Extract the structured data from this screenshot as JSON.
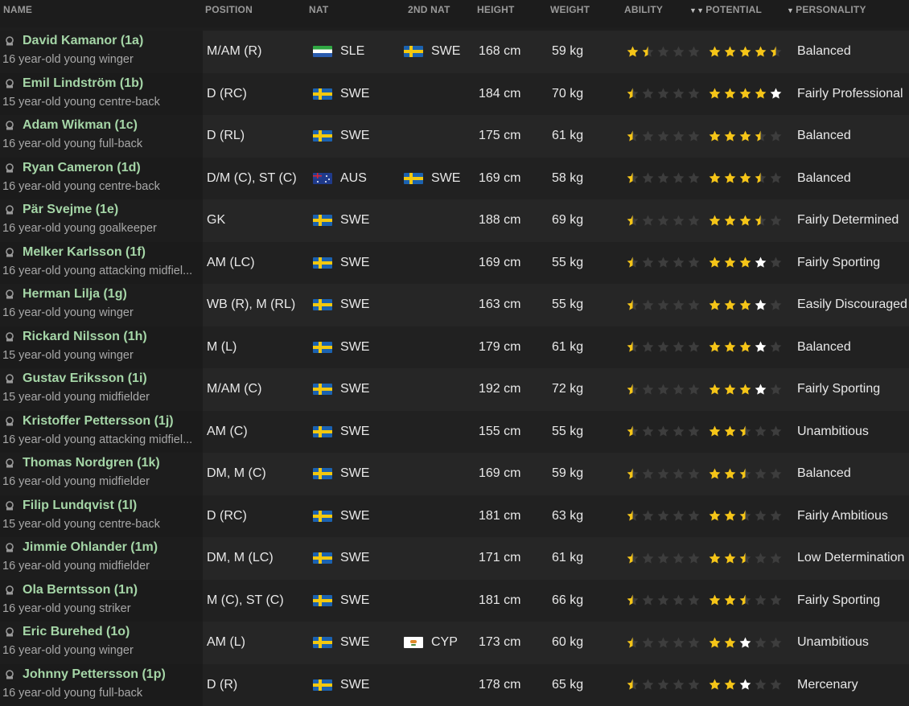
{
  "headers": {
    "name": "NAME",
    "position": "POSITION",
    "nat": "NAT",
    "second_nat": "2ND NAT",
    "height": "HEIGHT",
    "weight": "WEIGHT",
    "ability": "ABILITY",
    "potential": "POTENTIAL",
    "personality": "PERSONALITY"
  },
  "colors": {
    "name_green": "#a5d6a7",
    "star_gold": "#f5c518",
    "star_white": "#ffffff",
    "star_empty": "#3d3d3d"
  },
  "players": [
    {
      "name": "David Kamanor (1a)",
      "desc": "16 year-old young winger",
      "position": "M/AM (R)",
      "nat": "SLE",
      "nat_flag": "sle",
      "second_nat": "SWE",
      "second_flag": "swe",
      "height": "168 cm",
      "weight": "59 kg",
      "ability": 1.5,
      "potential": 4.5,
      "potential_white": 1,
      "personality": "Balanced"
    },
    {
      "name": "Emil Lindström (1b)",
      "desc": "15 year-old young centre-back",
      "position": "D (RC)",
      "nat": "SWE",
      "nat_flag": "swe",
      "second_nat": "",
      "second_flag": "",
      "height": "184 cm",
      "weight": "70 kg",
      "ability": 0.5,
      "potential": 4,
      "potential_white": 1,
      "personality": "Fairly Professional"
    },
    {
      "name": "Adam Wikman (1c)",
      "desc": "16 year-old young full-back",
      "position": "D (RL)",
      "nat": "SWE",
      "nat_flag": "swe",
      "second_nat": "",
      "second_flag": "",
      "height": "175 cm",
      "weight": "61 kg",
      "ability": 0.5,
      "potential": 3.5,
      "potential_white": 0,
      "personality": "Balanced"
    },
    {
      "name": "Ryan Cameron (1d)",
      "desc": "16 year-old young centre-back",
      "position": "D/M (C), ST (C)",
      "nat": "AUS",
      "nat_flag": "aus",
      "second_nat": "SWE",
      "second_flag": "swe",
      "height": "169 cm",
      "weight": "58 kg",
      "ability": 0.5,
      "potential": 3.5,
      "potential_white": 0,
      "personality": "Balanced"
    },
    {
      "name": "Pär Svejme (1e)",
      "desc": "16 year-old young goalkeeper",
      "position": "GK",
      "nat": "SWE",
      "nat_flag": "swe",
      "second_nat": "",
      "second_flag": "",
      "height": "188 cm",
      "weight": "69 kg",
      "ability": 0.5,
      "potential": 3.5,
      "potential_white": 0,
      "personality": "Fairly Determined"
    },
    {
      "name": "Melker Karlsson (1f)",
      "desc": "16 year-old young attacking midfiel...",
      "position": "AM (LC)",
      "nat": "SWE",
      "nat_flag": "swe",
      "second_nat": "",
      "second_flag": "",
      "height": "169 cm",
      "weight": "55 kg",
      "ability": 0.5,
      "potential": 3,
      "potential_white": 1,
      "personality": "Fairly Sporting"
    },
    {
      "name": "Herman Lilja (1g)",
      "desc": "16 year-old young winger",
      "position": "WB (R), M (RL)",
      "nat": "SWE",
      "nat_flag": "swe",
      "second_nat": "",
      "second_flag": "",
      "height": "163 cm",
      "weight": "55 kg",
      "ability": 0.5,
      "potential": 3,
      "potential_white": 1,
      "personality": "Easily Discouraged"
    },
    {
      "name": "Rickard Nilsson (1h)",
      "desc": "15 year-old young winger",
      "position": "M (L)",
      "nat": "SWE",
      "nat_flag": "swe",
      "second_nat": "",
      "second_flag": "",
      "height": "179 cm",
      "weight": "61 kg",
      "ability": 0.5,
      "potential": 3,
      "potential_white": 1,
      "personality": "Balanced"
    },
    {
      "name": "Gustav Eriksson (1i)",
      "desc": "15 year-old young midfielder",
      "position": "M/AM (C)",
      "nat": "SWE",
      "nat_flag": "swe",
      "second_nat": "",
      "second_flag": "",
      "height": "192 cm",
      "weight": "72 kg",
      "ability": 0.5,
      "potential": 3,
      "potential_white": 1,
      "personality": "Fairly Sporting"
    },
    {
      "name": "Kristoffer Pettersson (1j)",
      "desc": "16 year-old young attacking midfiel...",
      "position": "AM (C)",
      "nat": "SWE",
      "nat_flag": "swe",
      "second_nat": "",
      "second_flag": "",
      "height": "155 cm",
      "weight": "55 kg",
      "ability": 0.5,
      "potential": 2.5,
      "potential_white": 0,
      "personality": "Unambitious"
    },
    {
      "name": "Thomas Nordgren (1k)",
      "desc": "16 year-old young midfielder",
      "position": "DM, M (C)",
      "nat": "SWE",
      "nat_flag": "swe",
      "second_nat": "",
      "second_flag": "",
      "height": "169 cm",
      "weight": "59 kg",
      "ability": 0.5,
      "potential": 2.5,
      "potential_white": 0,
      "personality": "Balanced"
    },
    {
      "name": "Filip Lundqvist (1l)",
      "desc": "15 year-old young centre-back",
      "position": "D (RC)",
      "nat": "SWE",
      "nat_flag": "swe",
      "second_nat": "",
      "second_flag": "",
      "height": "181 cm",
      "weight": "63 kg",
      "ability": 0.5,
      "potential": 2.5,
      "potential_white": 0,
      "personality": "Fairly Ambitious"
    },
    {
      "name": "Jimmie Ohlander (1m)",
      "desc": "16 year-old young midfielder",
      "position": "DM, M (LC)",
      "nat": "SWE",
      "nat_flag": "swe",
      "second_nat": "",
      "second_flag": "",
      "height": "171 cm",
      "weight": "61 kg",
      "ability": 0.5,
      "potential": 2.5,
      "potential_white": 0,
      "personality": "Low Determination"
    },
    {
      "name": "Ola Berntsson (1n)",
      "desc": "16 year-old young striker",
      "position": "M (C), ST (C)",
      "nat": "SWE",
      "nat_flag": "swe",
      "second_nat": "",
      "second_flag": "",
      "height": "181 cm",
      "weight": "66 kg",
      "ability": 0.5,
      "potential": 2.5,
      "potential_white": 0,
      "personality": "Fairly Sporting"
    },
    {
      "name": "Eric Burehed (1o)",
      "desc": "16 year-old young winger",
      "position": "AM (L)",
      "nat": "SWE",
      "nat_flag": "swe",
      "second_nat": "CYP",
      "second_flag": "cyp",
      "height": "173 cm",
      "weight": "60 kg",
      "ability": 0.5,
      "potential": 2,
      "potential_white": 1,
      "personality": "Unambitious"
    },
    {
      "name": "Johnny Pettersson (1p)",
      "desc": "16 year-old young full-back",
      "position": "D (R)",
      "nat": "SWE",
      "nat_flag": "swe",
      "second_nat": "",
      "second_flag": "",
      "height": "178 cm",
      "weight": "65 kg",
      "ability": 0.5,
      "potential": 2,
      "potential_white": 1,
      "personality": "Mercenary"
    }
  ]
}
